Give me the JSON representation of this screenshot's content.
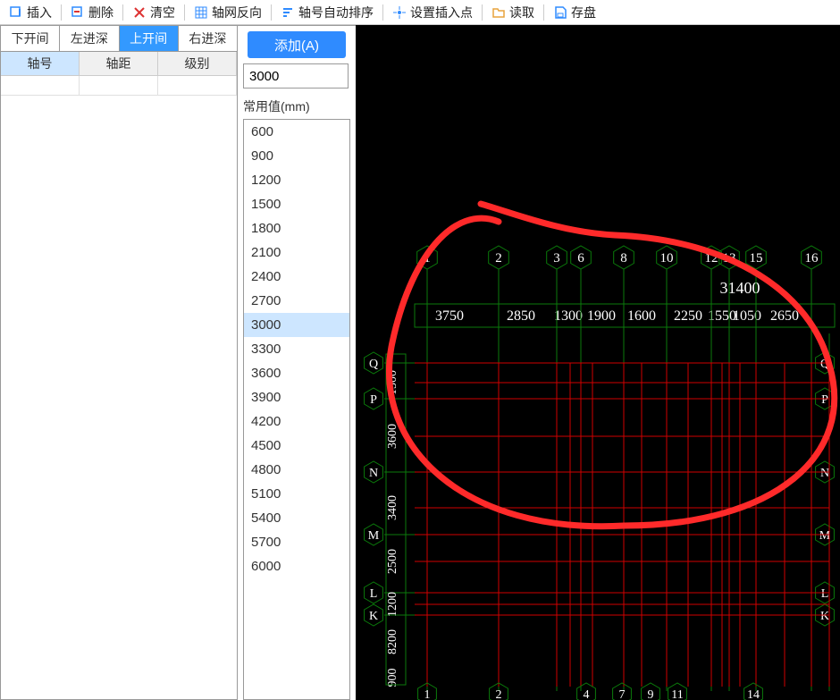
{
  "toolbar": {
    "insert": "插入",
    "delete": "删除",
    "clear": "清空",
    "grid_reverse": "轴网反向",
    "axis_autosort": "轴号自动排序",
    "set_insertpoint": "设置插入点",
    "read": "读取",
    "save": "存盘"
  },
  "tabs": {
    "items": [
      "下开间",
      "左进深",
      "上开间",
      "右进深"
    ],
    "active_index": 2
  },
  "grid": {
    "columns": [
      "轴号",
      "轴距",
      "级别"
    ],
    "selected_col_index": 0
  },
  "mid": {
    "add_label": "添加(A)",
    "value": "3000",
    "common_label": "常用值(mm)",
    "presets": [
      "600",
      "900",
      "1200",
      "1500",
      "1800",
      "2100",
      "2400",
      "2700",
      "3000",
      "3300",
      "3600",
      "3900",
      "4200",
      "4500",
      "4800",
      "5100",
      "5400",
      "5700",
      "6000"
    ],
    "selected_preset": "3000"
  },
  "canvas": {
    "top_total": "31400",
    "top_axis_numbers": [
      "1",
      "2",
      "3",
      "6",
      "8",
      "10",
      "12",
      "13",
      "15",
      "16"
    ],
    "top_dims": [
      "3750",
      "2850",
      "1300",
      "1900",
      "1600",
      "2250",
      "1550",
      "1050",
      "2650"
    ],
    "left_letters_top": [
      "Q",
      "P",
      "N",
      "M",
      "L",
      "K"
    ],
    "left_letters_bottom": [
      "Q",
      "P",
      "N",
      "M",
      "L",
      "K"
    ],
    "left_dims": [
      "1500",
      "3600",
      "3400",
      "2500",
      "1200",
      "8200",
      "900"
    ],
    "bottom_axis_numbers": [
      "1",
      "2",
      "4",
      "7",
      "9",
      "11",
      "14"
    ],
    "right_letters": [
      "Q",
      "P",
      "N",
      "M",
      "L",
      "K"
    ]
  }
}
